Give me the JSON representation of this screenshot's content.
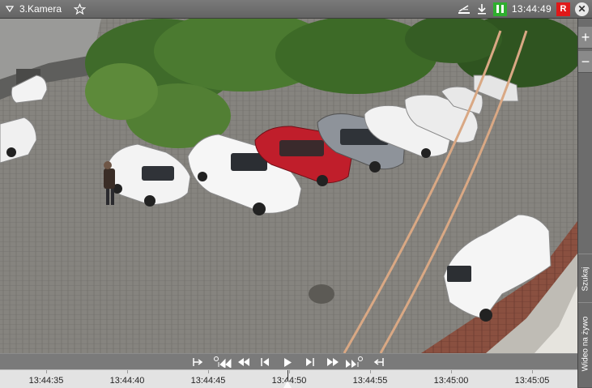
{
  "camera": {
    "name": "3.Kamera"
  },
  "status": {
    "time": "13:44:49",
    "rec_label": "R"
  },
  "sidebar": {
    "search_label": "Szukaj",
    "live_label": "Wideo na żywo"
  },
  "timeline": {
    "labels": [
      "13:44:35",
      "13:44:40",
      "13:44:45",
      "13:44:50",
      "13:44:55",
      "13:45:00",
      "13:45:05"
    ]
  },
  "colors": {
    "rec": "#e01818",
    "pause": "#2fae2f",
    "titlebar": "#6e6e6e"
  }
}
